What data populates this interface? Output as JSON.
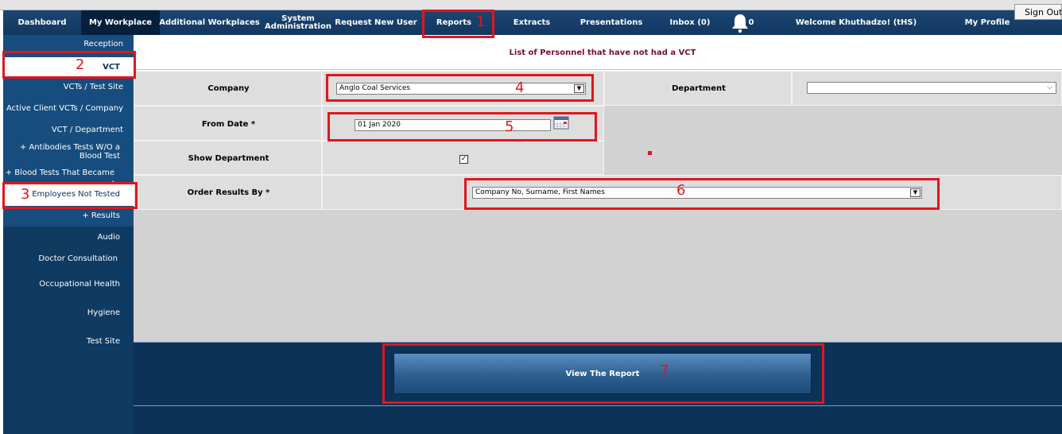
{
  "nav": {
    "items": [
      {
        "label": "Dashboard",
        "active": false
      },
      {
        "label": "My Workplace",
        "active": true
      },
      {
        "label": "Additional Workplaces",
        "active": false
      },
      {
        "label": "System Administration",
        "active": false
      },
      {
        "label": "Request New User",
        "active": false
      },
      {
        "label": "Reports",
        "active": false
      },
      {
        "label": "Extracts",
        "active": false
      },
      {
        "label": "Presentations",
        "active": false
      },
      {
        "label": "Inbox (0)",
        "active": false
      }
    ],
    "bell_icon": "bell-icon",
    "bell_count": "0",
    "welcome": "Welcome Khuthadzo! (tHS)",
    "my_profile": "My Profile",
    "sign_out": "Sign Out"
  },
  "sidebar": {
    "items": [
      {
        "label": "Reception"
      },
      {
        "label": "VCT",
        "selected": true
      },
      {
        "label": "VCTs / Test Site"
      },
      {
        "label": "Active Client VCTs / Company"
      },
      {
        "label": "VCT / Department"
      },
      {
        "label": "+ Antibodies Tests W/O a Blood Test"
      },
      {
        "label": "+ Blood Tests That Became -"
      },
      {
        "label": "Employees Not Tested",
        "selected": true
      },
      {
        "label": "+ Results"
      },
      {
        "label": "Audio"
      },
      {
        "label": "Doctor Consultation"
      },
      {
        "label": "Occupational Health"
      },
      {
        "label": "Hygiene"
      },
      {
        "label": "Test Site"
      }
    ]
  },
  "main": {
    "title": "List of Personnel that have not had a VCT",
    "company_label": "Company",
    "company_value": "Anglo Coal Services",
    "department_label": "Department",
    "department_value": "",
    "from_date_label": "From Date *",
    "from_date_value": "01 Jan 2020",
    "calendar_icon": "calendar-icon",
    "show_department_label": "Show Department",
    "show_department_checked": true,
    "check_mark": "✓",
    "order_by_label": "Order Results By *",
    "order_by_value": "Company No, Surname, First Names",
    "view_report": "View The Report"
  },
  "annotations": [
    "1",
    "2",
    "3",
    "4",
    "5",
    "6",
    "7"
  ],
  "colors": {
    "nav_bg": "#1b4572",
    "sidebar_bg": "#164d7e",
    "title_text": "#7a0f2a",
    "annotation_red": "#e0161e"
  }
}
